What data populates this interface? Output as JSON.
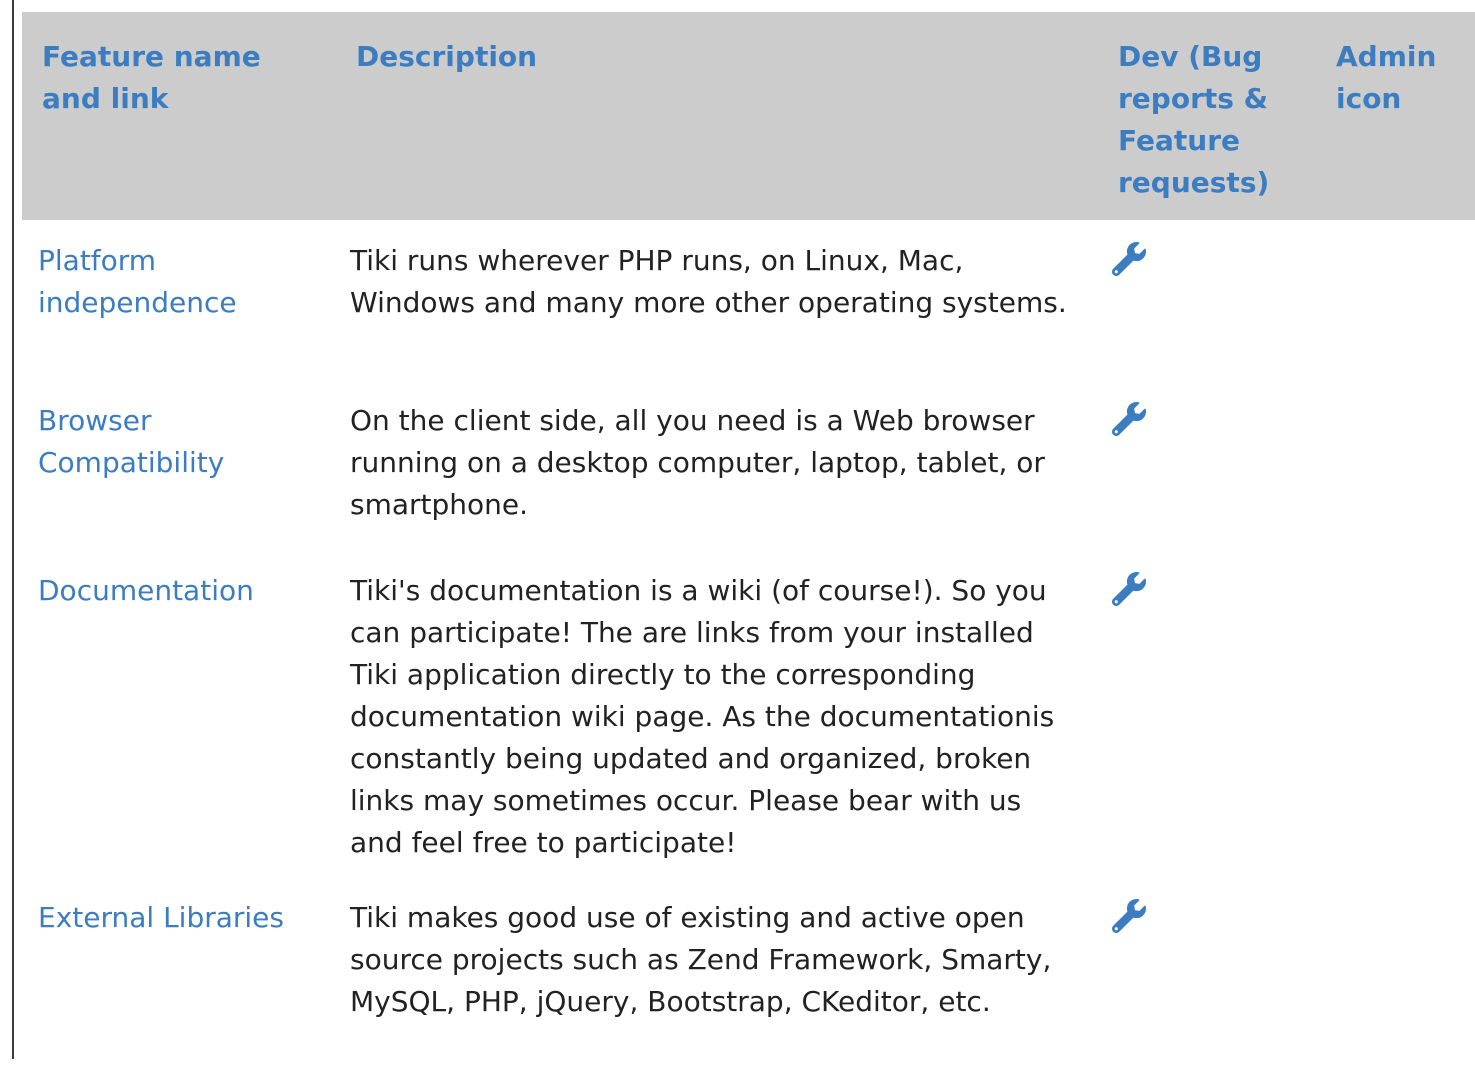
{
  "table": {
    "headers": {
      "feature": "Feature name and link",
      "description": "Description",
      "dev": "Dev (Bug reports & Feature requests)",
      "admin": "Admin icon"
    },
    "rows": [
      {
        "name": "Platform independence",
        "description": "Tiki runs wherever PHP runs, on Linux, Mac, Windows and many more other operating systems.",
        "dev_icon": "wrench-icon"
      },
      {
        "name": "Browser Compatibility",
        "description": "On the client side, all you need is a Web browser running on a desktop computer, laptop, tablet, or smartphone.",
        "dev_icon": "wrench-icon"
      },
      {
        "name": "Documentation",
        "description": "Tiki's documentation is a wiki (of course!). So you can participate! The are links from your installed Tiki application directly to the corresponding documentation wiki page. As the documentationis constantly being updated and organized, broken links may sometimes occur. Please bear with us and feel free to participate!",
        "dev_icon": "wrench-icon"
      },
      {
        "name": "External Libraries",
        "description": "Tiki makes good use of existing and active open source projects such as Zend Framework, Smarty, MySQL, PHP, jQuery, Bootstrap, CKeditor, etc.",
        "dev_icon": "wrench-icon"
      }
    ]
  },
  "colors": {
    "header_bg": "#cccccc",
    "link": "#3b7dc0",
    "text": "#222222"
  }
}
